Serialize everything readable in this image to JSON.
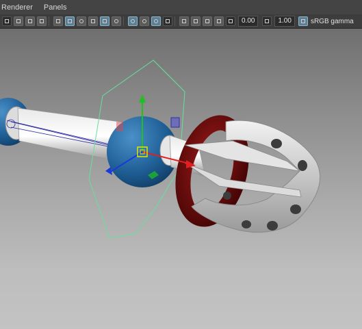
{
  "menubar": {
    "items": [
      "Renderer",
      "Panels"
    ]
  },
  "toolbar": {
    "exposure_value": "0.00",
    "gamma_value": "1.00",
    "color_space_label": "sRGB gamma",
    "icons": [
      "camera-icon",
      "image-plane-icon",
      "grid-toggle-icon",
      "film-gate-icon",
      "wireframe-icon",
      "smooth-shade-icon",
      "textured-icon",
      "xray-icon",
      "lighting-icon",
      "shadows-icon",
      "screen-space-ao-icon",
      "motion-blur-icon",
      "isolate-select-icon",
      "xray-joints-icon",
      "select-camera-icon",
      "resolution-gate-icon",
      "safe-title-icon",
      "field-chart-icon"
    ],
    "accent_color": "#5d7f93"
  },
  "viewport": {
    "background_top": "#6f6f6f",
    "background_bottom": "#c3c3c3",
    "manipulator": {
      "x_axis_color": "#e02020",
      "y_axis_color": "#20c020",
      "z_axis_color": "#1a3ad6",
      "rotate_ring_color": "#66e0a0"
    },
    "objects": [
      "blue-joint-sphere",
      "metal-rod",
      "red-torus",
      "grip-claw"
    ]
  }
}
